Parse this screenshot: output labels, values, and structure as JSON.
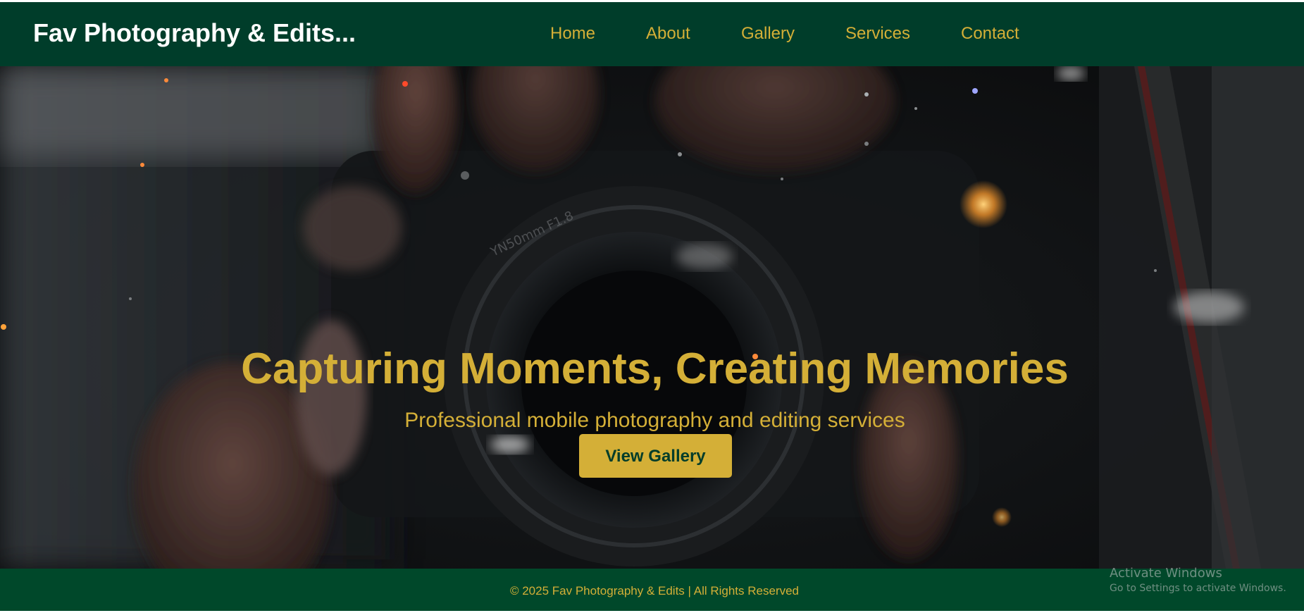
{
  "brand": {
    "name": "Fav Photography & Edits..."
  },
  "nav": {
    "items": [
      {
        "label": "Home"
      },
      {
        "label": "About"
      },
      {
        "label": "Gallery"
      },
      {
        "label": "Services"
      },
      {
        "label": "Contact"
      }
    ]
  },
  "hero": {
    "title": "Capturing Moments, Creating Memories",
    "subtitle": "Professional mobile photography and editing services",
    "cta_label": "View Gallery",
    "background_image": "hands holding a camera with lens facing viewer, dark tones"
  },
  "footer": {
    "copyright": "© 2025 Fav Photography & Edits | All Rights Reserved"
  },
  "system_watermark": {
    "title": "Activate Windows",
    "subtitle": "Go to Settings to activate Windows."
  },
  "colors": {
    "header_bg": "#003d2a",
    "footer_bg": "#00482a",
    "accent_gold": "#d4af37",
    "brand_text": "#ffffff"
  }
}
